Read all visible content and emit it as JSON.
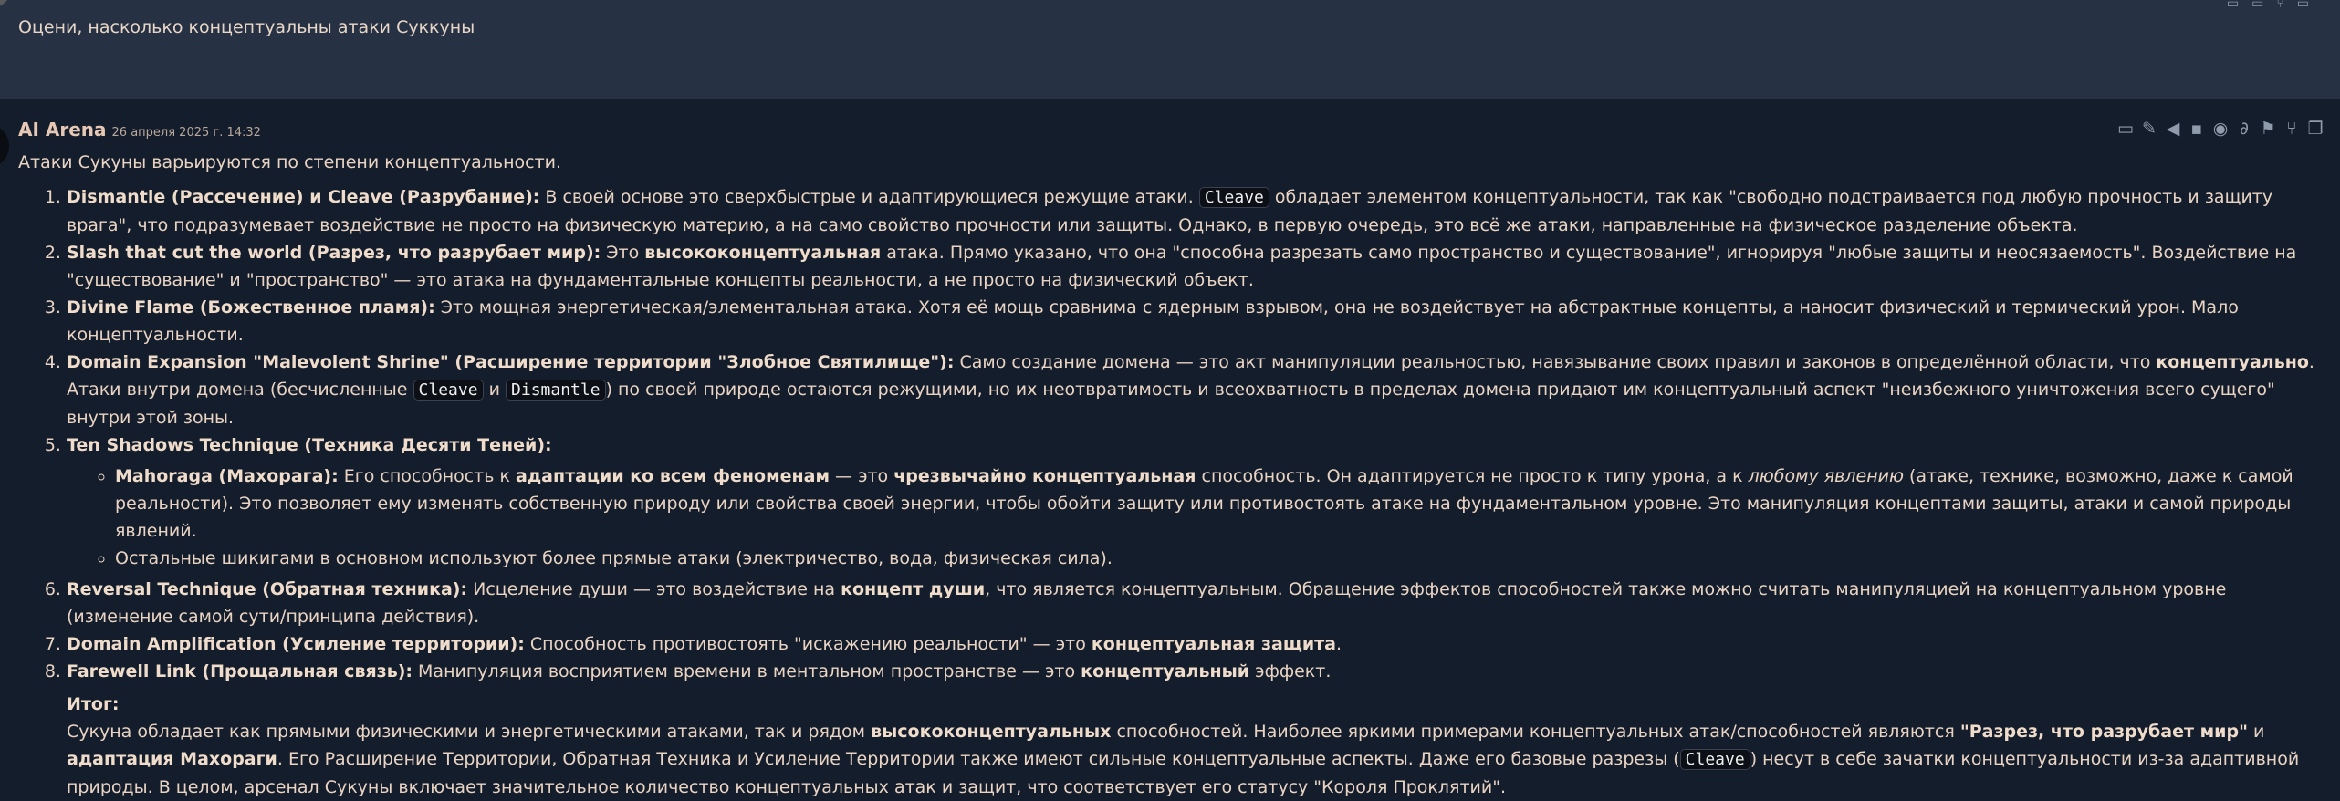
{
  "top_message": {
    "text": "Оцени, насколько концептуальны атаки Суккуны"
  },
  "message": {
    "author": "AI Arena",
    "date": "26 апреля 2025 г. 14:32",
    "intro": "Атаки Сукуны варьируются по степени концептуальности.",
    "items": [
      {
        "title": "Dismantle (Рассечение) и Cleave (Разрубание):",
        "t1": " В своей основе это сверхбыстрые и адаптирующиеся режущие атаки. ",
        "code1": "Cleave",
        "t2": " обладает элементом концептуальности, так как \"свободно подстраивается под любую прочность и защиту врага\", что подразумевает воздействие не просто на физическую материю, а на само свойство прочности или защиты. Однако, в первую очередь, это всё же атаки, направленные на физическое разделение объекта."
      },
      {
        "title": "Slash that cut the world (Разрез, что разрубает мир):",
        "t1": " Это ",
        "b1": "высококонцептуальная",
        "t2": " атака. Прямо указано, что она \"способна разрезать само пространство и существование\", игнорируя \"любые защиты и неосязаемость\". Воздействие на \"существование\" и \"пространство\" — это атака на фундаментальные концепты реальности, а не просто на физический объект."
      },
      {
        "title": "Divine Flame (Божественное пламя):",
        "t1": " Это мощная энергетическая/элементальная атака. Хотя её мощь сравнима с ядерным взрывом, она не воздействует на абстрактные концепты, а наносит физический и термический урон. Мало концептуальности."
      },
      {
        "title": "Domain Expansion \"Malevolent Shrine\" (Расширение территории \"Злобное Святилище\"):",
        "t1": " Само создание домена — это акт манипуляции реальностью, навязывание своих правил и законов в определённой области, что ",
        "b1": "концептуально",
        "t2": ". Атаки внутри домена (бесчисленные ",
        "code1": "Cleave",
        "t3": " и ",
        "code2": "Dismantle",
        "t4": ") по своей природе остаются режущими, но их неотвратимость и всеохватность в пределах домена придают им концептуальный аспект \"неизбежного уничтожения всего сущего\" внутри этой зоны."
      },
      {
        "title": "Ten Shadows Technique (Техника Десяти Теней):",
        "sub": [
          {
            "title": "Mahoraga (Махорага):",
            "t1": " Его способность к ",
            "b1": "адаптации ко всем феноменам",
            "t2": " — это ",
            "b2": "чрезвычайно концептуальная",
            "t3": " способность. Он адаптируется не просто к типу урона, а к ",
            "i1": "любому явлению",
            "t4": " (атаке, технике, возможно, даже к самой реальности). Это позволяет ему изменять собственную природу или свойства своей энергии, чтобы обойти защиту или противостоять атаке на фундаментальном уровне. Это манипуляция концептами защиты, атаки и самой природы явлений."
          },
          {
            "t1": "Остальные шикигами в основном используют более прямые атаки (электричество, вода, физическая сила)."
          }
        ]
      },
      {
        "title": "Reversal Technique (Обратная техника):",
        "t1": " Исцеление души — это воздействие на ",
        "b1": "концепт души",
        "t2": ", что является концептуальным. Обращение эффектов способностей также можно считать манипуляцией на концептуальном уровне (изменение самой сути/принципа действия)."
      },
      {
        "title": "Domain Amplification (Усиление территории):",
        "t1": " Способность противостоять \"искажению реальности\" — это ",
        "b1": "концептуальная защита",
        "t2": "."
      },
      {
        "title": "Farewell Link (Прощальная связь):",
        "t1": " Манипуляция восприятием времени в ментальном пространстве — это ",
        "b1": "концептуальный",
        "t2": " эффект."
      }
    ],
    "summary": {
      "heading": "Итог:",
      "t1": "Сукуна обладает как прямыми физическими и энергетическими атаками, так и рядом ",
      "b1": "высококонцептуальных",
      "t2": " способностей. Наиболее яркими примерами концептуальных атак/способностей являются ",
      "b2": "\"Разрез, что разрубает мир\"",
      "t3": " и ",
      "b3": "адаптация Махораги",
      "t4": ". Его Расширение Территории, Обратная Техника и Усиление Территории также имеют сильные концептуальные аспекты. Даже его базовые разрезы (",
      "code1": "Cleave",
      "t5": ") несут в себе зачатки концептуальности из-за адаптивной природы. В целом, арсенал Сукуны включает значительное количество концептуальных атак и защит, что соответствует его статусу \"Короля Проклятий\"."
    }
  },
  "toolbar_icons": [
    "translate-icon",
    "pen-icon",
    "megaphone-icon",
    "bookmark-icon",
    "eye-icon",
    "paperclip-icon",
    "flag-icon",
    "branch-icon",
    "copy-icon"
  ]
}
